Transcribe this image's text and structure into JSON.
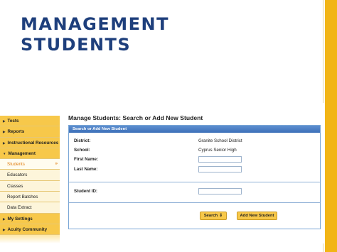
{
  "slide": {
    "title_line1": "MANAGEMENT",
    "title_line2": "STUDENTS"
  },
  "sidebar": {
    "items": [
      {
        "label": "Tests",
        "type": "section"
      },
      {
        "label": "Reports",
        "type": "section"
      },
      {
        "label": "Instructional Resources",
        "type": "section"
      },
      {
        "label": "Management",
        "type": "section"
      },
      {
        "label": "Students",
        "type": "sub",
        "active": true
      },
      {
        "label": "Educators",
        "type": "sub"
      },
      {
        "label": "Classes",
        "type": "sub"
      },
      {
        "label": "Report Batches",
        "type": "sub"
      },
      {
        "label": "Data Extract",
        "type": "sub"
      },
      {
        "label": "My Settings",
        "type": "section"
      },
      {
        "label": "Acuity Community",
        "type": "section"
      }
    ],
    "active_arrow": "»"
  },
  "main": {
    "heading": "Manage Students: Search or Add New Student",
    "panel_title": "Search or Add New Student",
    "district_label": "District:",
    "district_value": "Granite School District",
    "school_label": "School:",
    "school_value": "Cyprus Senior High",
    "first_name_label": "First Name:",
    "first_name_value": "",
    "last_name_label": "Last Name:",
    "last_name_value": "",
    "student_id_label": "Student ID:",
    "student_id_value": "",
    "search_button": "Search",
    "add_button": "Add New Student"
  },
  "colors": {
    "title": "#1e3f7c",
    "accent": "#f2b516",
    "panel_header": "#3c6fb8"
  }
}
